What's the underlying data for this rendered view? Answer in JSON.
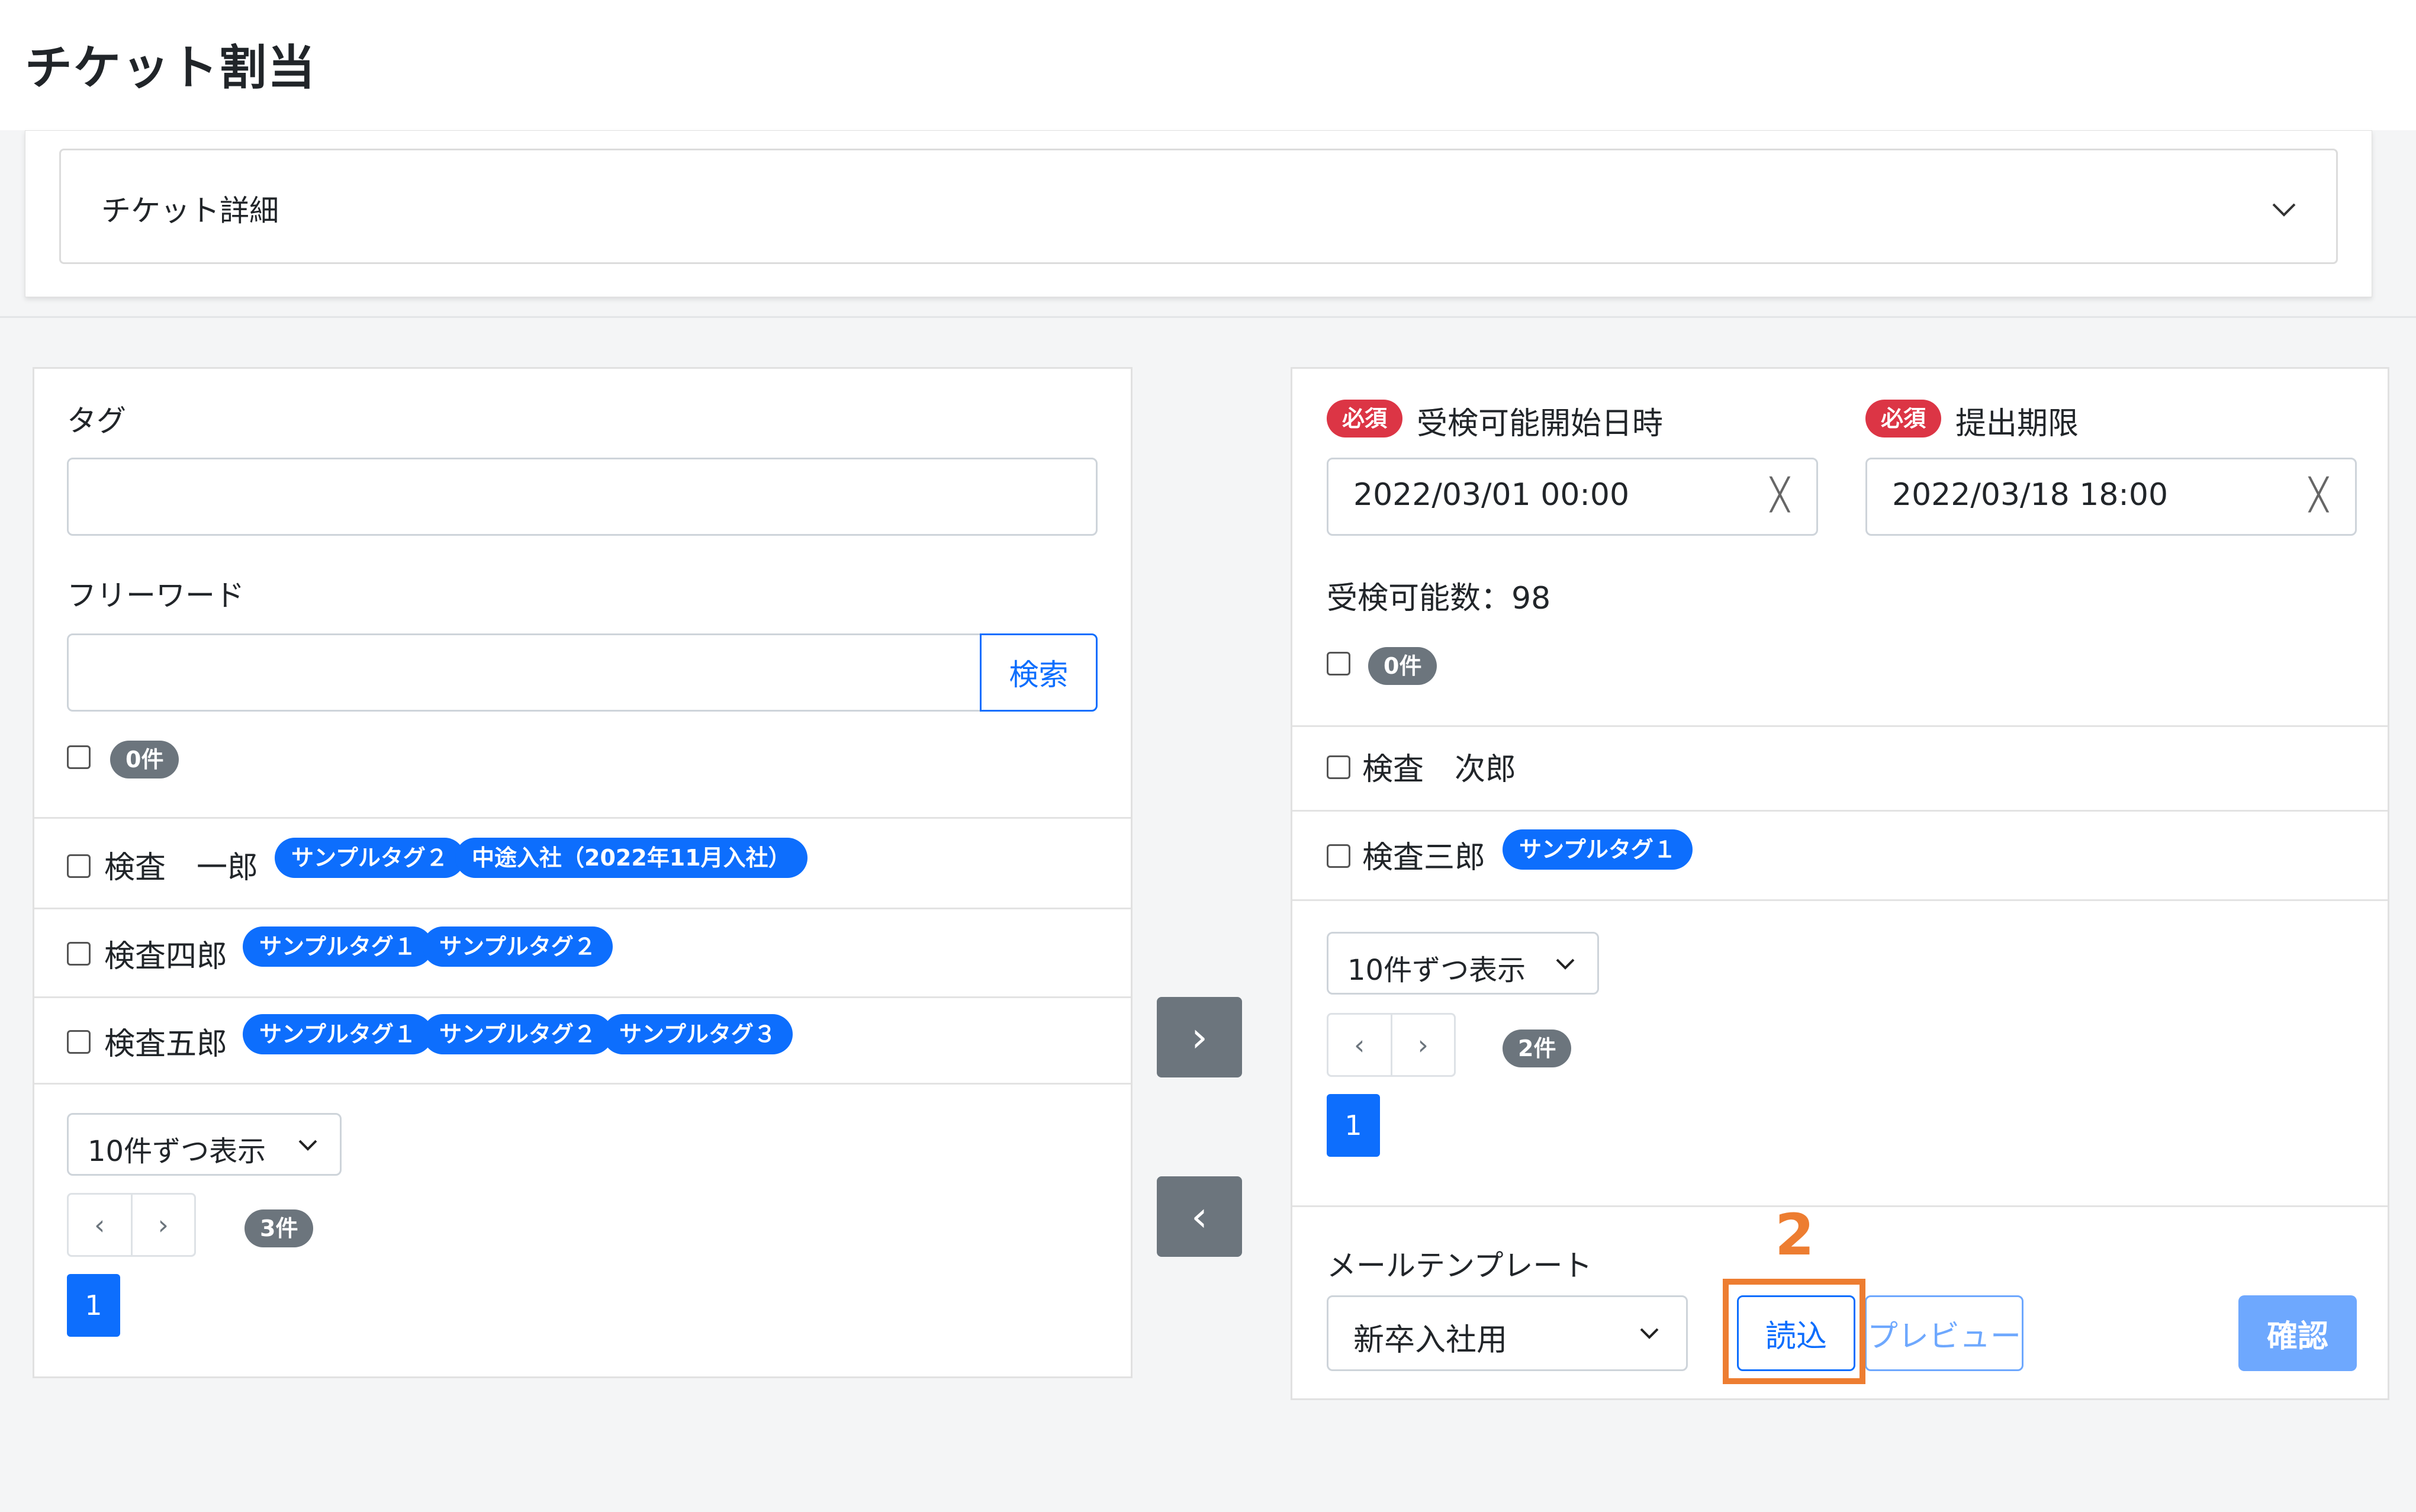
{
  "page": {
    "title": "チケット割当"
  },
  "details": {
    "label": "チケット詳細"
  },
  "left": {
    "tag_label": "タグ",
    "tag_value": "",
    "freeword_label": "フリーワード",
    "freeword_value": "",
    "search_button": "検索",
    "selected_count": "0件",
    "rows": [
      {
        "name": "検査　一郎",
        "tags": [
          "サンプルタグ２",
          "中途入社（2022年11月入社）"
        ]
      },
      {
        "name": "検査四郎",
        "tags": [
          "サンプルタグ１",
          "サンプルタグ２"
        ]
      },
      {
        "name": "検査五郎",
        "tags": [
          "サンプルタグ１",
          "サンプルタグ２",
          "サンプルタグ３"
        ]
      }
    ],
    "page_size": "10件ずつ表示",
    "pager": {
      "prev": "‹",
      "next": "›"
    },
    "total": "3件",
    "current_page": "1"
  },
  "transfer": {
    "right": "›",
    "left": "‹"
  },
  "right": {
    "required_badge": "必須",
    "start_label": "受検可能開始日時",
    "start_value": "2022/03/01 00:00",
    "deadline_label": "提出期限",
    "deadline_value": "2022/03/18 18:00",
    "clear_icon": "╳",
    "available_count": "受検可能数：98",
    "selected_count": "0件",
    "rows": [
      {
        "name": "検査　次郎",
        "tags": []
      },
      {
        "name": "検査三郎",
        "tags": [
          "サンプルタグ１"
        ]
      }
    ],
    "page_size": "10件ずつ表示",
    "pager": {
      "prev": "‹",
      "next": "›"
    },
    "total": "2件",
    "current_page": "1",
    "mail_template_label": "メールテンプレート",
    "mail_template_value": "新卒入社用",
    "load_button": "読込",
    "preview_button": "プレビュー",
    "confirm_button": "確認"
  },
  "annotation": {
    "step_number": "2",
    "color": "#ed7d31"
  }
}
